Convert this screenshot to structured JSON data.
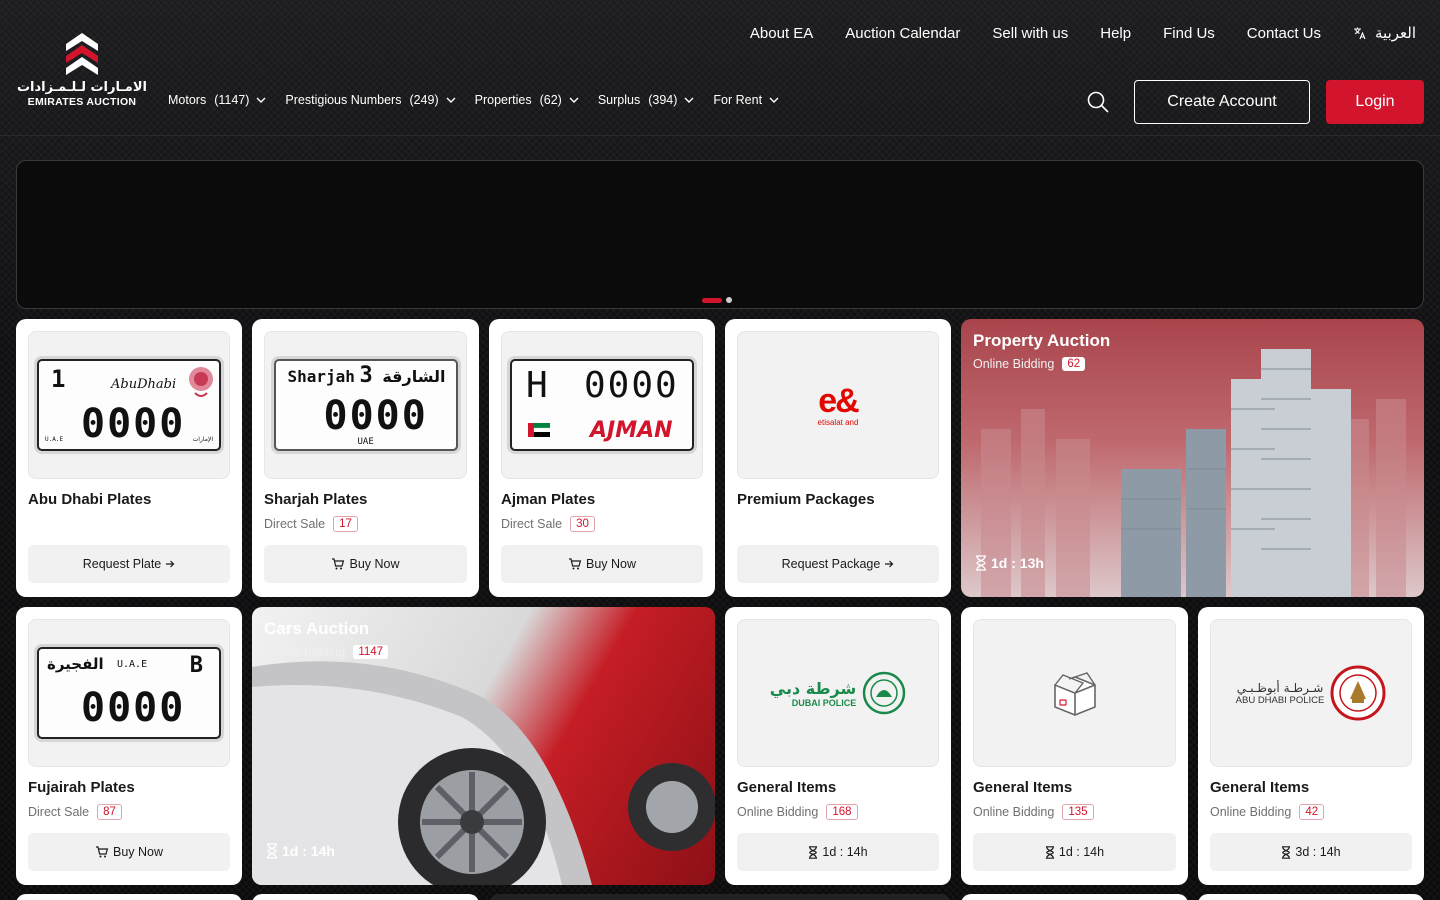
{
  "brand": {
    "arabic": "الامـارات لـلـمـزادات",
    "english": "EMIRATES AUCTION",
    "colors": {
      "accent": "#d2142c",
      "background": "#0e0e10",
      "card": "#ffffff"
    }
  },
  "topnav": {
    "items": [
      {
        "label": "About EA"
      },
      {
        "label": "Auction Calendar"
      },
      {
        "label": "Sell with us"
      },
      {
        "label": "Help"
      },
      {
        "label": "Find Us"
      },
      {
        "label": "Contact Us"
      }
    ],
    "language_label": "العربية"
  },
  "mainnav": {
    "items": [
      {
        "label": "Motors",
        "count": "(1147)"
      },
      {
        "label": "Prestigious Numbers",
        "count": "(249)"
      },
      {
        "label": "Properties",
        "count": "(62)"
      },
      {
        "label": "Surplus",
        "count": "(394)"
      },
      {
        "label": "For Rent",
        "count": ""
      }
    ]
  },
  "header_actions": {
    "search_icon": "search-icon",
    "create_account": "Create Account",
    "login": "Login"
  },
  "banner": {
    "slides_total": 2,
    "active_slide": 1
  },
  "cards_row1": [
    {
      "title": "Abu Dhabi Plates",
      "meta_label": "",
      "count": "",
      "action": "Request Plate",
      "action_icon": "arrow-right-icon",
      "plate": {
        "num": "1",
        "city": "AbuDhabi",
        "digits": "0000",
        "small_left": "U.A.E",
        "small_right": "الإمارات"
      }
    },
    {
      "title": "Sharjah Plates",
      "meta_label": "Direct Sale",
      "count": "17",
      "action": "Buy Now",
      "action_icon": "cart-icon",
      "plate": {
        "city": "Sharjah",
        "num": "3",
        "arabic": "الشارقة",
        "digits": "0000",
        "bottom": "UAE"
      }
    },
    {
      "title": "Ajman Plates",
      "meta_label": "Direct Sale",
      "count": "30",
      "action": "Buy Now",
      "action_icon": "cart-icon",
      "plate": {
        "letter": "H",
        "digits": "0000",
        "city": "AJMAN"
      }
    },
    {
      "title": "Premium Packages",
      "meta_label": "",
      "count": "",
      "action": "Request Package",
      "action_icon": "arrow-right-icon",
      "logo": {
        "mark": "e&",
        "sub": "etisalat and"
      }
    }
  ],
  "property_feature": {
    "title": "Property Auction",
    "meta_label": "Online Bidding",
    "count": "62",
    "timer": "1d : 13h"
  },
  "cars_feature": {
    "title": "Cars Auction",
    "meta_label": "Online Bidding",
    "count": "1147",
    "timer": "1d : 14h"
  },
  "fujairah": {
    "title": "Fujairah Plates",
    "meta_label": "Direct Sale",
    "count": "87",
    "action": "Buy Now",
    "plate": {
      "arabic": "الفجيرة",
      "center": "U.A.E",
      "letter": "B",
      "digits": "0000"
    }
  },
  "general_items": [
    {
      "title": "General Items",
      "meta_label": "Online Bidding",
      "count": "168",
      "timer": "1d : 14h",
      "logo": {
        "arabic": "شرطة دبي",
        "english": "DUBAI POLICE"
      }
    },
    {
      "title": "General Items",
      "meta_label": "Online Bidding",
      "count": "135",
      "timer": "1d : 14h",
      "logo": {
        "icon": "box-icon"
      }
    },
    {
      "title": "General Items",
      "meta_label": "Online Bidding",
      "count": "42",
      "timer": "3d : 14h",
      "logo": {
        "arabic": "شـرطـة أبوظـبـي",
        "english": "ABU DHABI POLICE"
      }
    }
  ]
}
